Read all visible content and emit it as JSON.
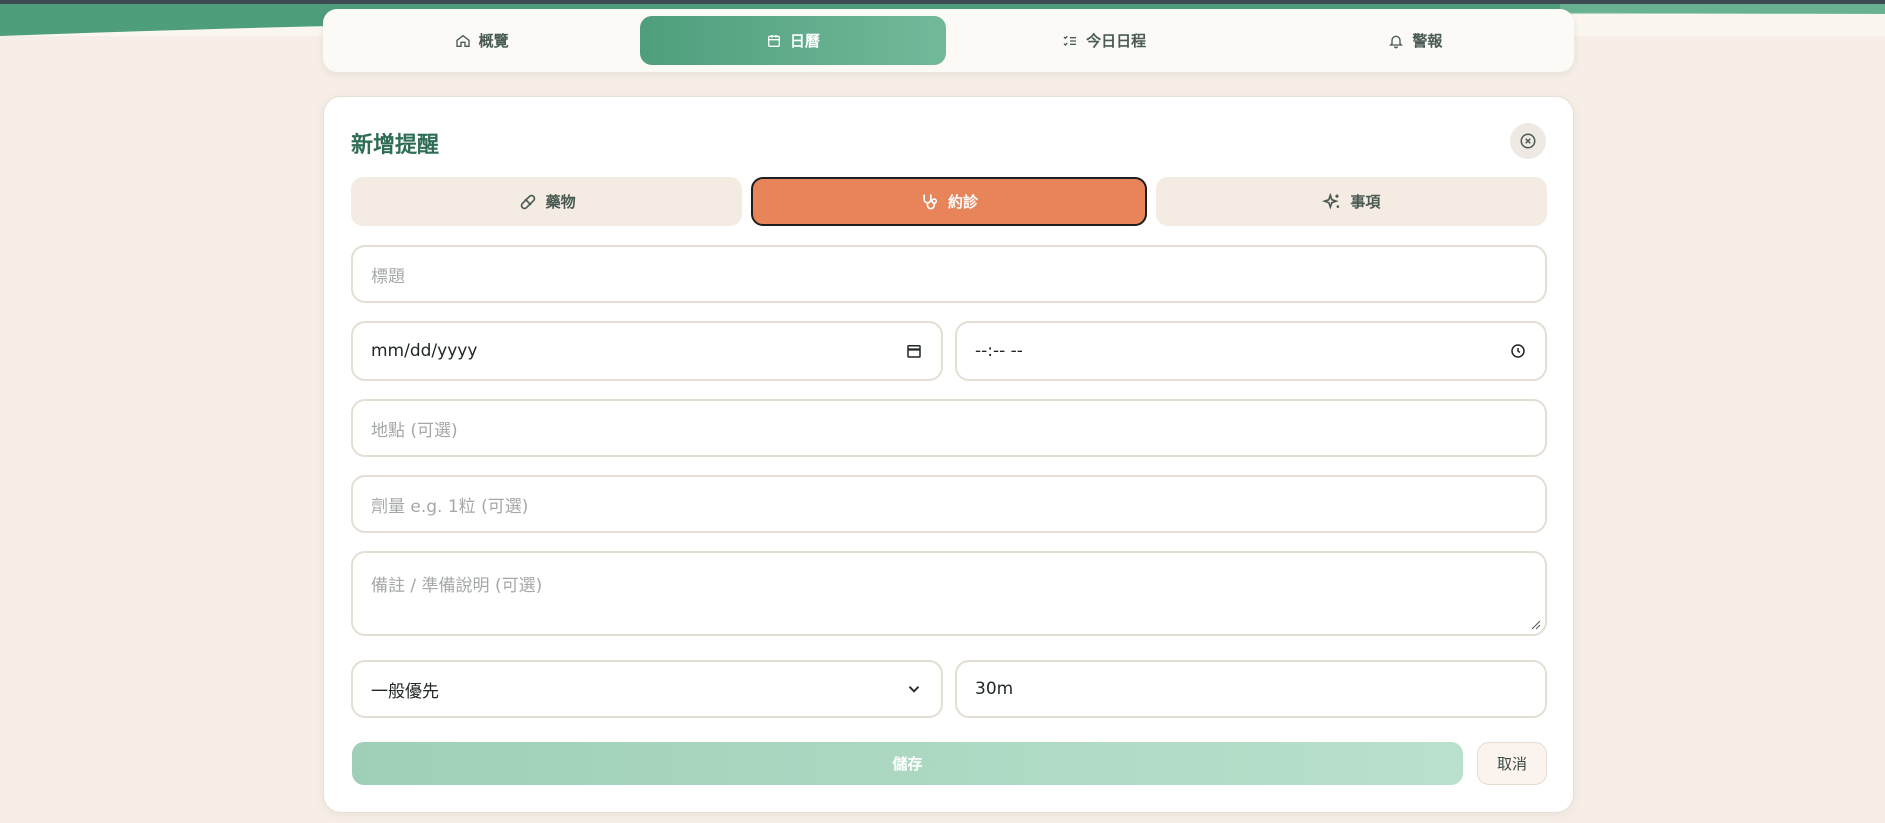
{
  "colors": {
    "accent_green": "#4e9e7c",
    "title_green": "#2f6e55",
    "appointment_orange": "#e8845a",
    "background": "#f7efe7"
  },
  "nav": {
    "tabs": [
      {
        "label": "概覽",
        "icon": "home-icon"
      },
      {
        "label": "日曆",
        "icon": "calendar-icon",
        "active": true
      },
      {
        "label": "今日日程",
        "icon": "checklist-icon"
      },
      {
        "label": "警報",
        "icon": "bell-icon"
      }
    ]
  },
  "form": {
    "title": "新增提醒",
    "types": [
      {
        "label": "藥物",
        "icon": "pill-icon"
      },
      {
        "label": "約診",
        "icon": "stethoscope-icon",
        "active": true
      },
      {
        "label": "事項",
        "icon": "sparkles-icon"
      }
    ],
    "title_placeholder": "標題",
    "date_value": "mm/dd/yyyy",
    "time_value": "--:-- --",
    "location_placeholder": "地點 (可選)",
    "dosage_placeholder": "劑量 e.g. 1粒 (可選)",
    "notes_placeholder": "備註 / 準備說明 (可選)",
    "priority_value": "一般優先",
    "remind_value": "30m",
    "save_label": "儲存",
    "cancel_label": "取消"
  }
}
